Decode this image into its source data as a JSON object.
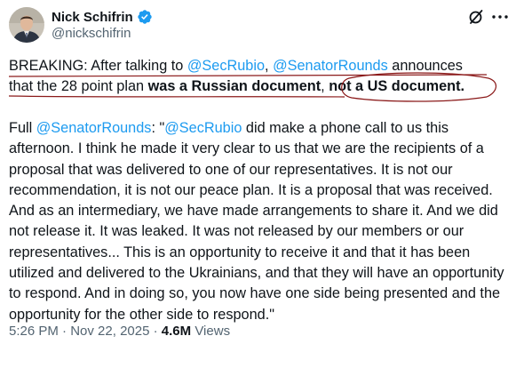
{
  "author": {
    "display_name": "Nick Schifrin",
    "handle": "@nickschifrin",
    "avatar_icon": "person-avatar",
    "verified_icon": "verified-badge-icon"
  },
  "actions": {
    "grok_icon": "grok-icon",
    "more_icon": "more-options-icon"
  },
  "post": {
    "line1": {
      "lead": "BREAKING: After talking to ",
      "mention1": "@SecRubio",
      "sep": ", ",
      "mention2": "@SenatorRounds",
      "tail": " announces"
    },
    "line2": {
      "lead": "that the 28 point plan ",
      "bold1": "was a Russian document",
      "sep": ", ",
      "bold2": "not a US document."
    },
    "para2": {
      "lead": "Full ",
      "mention1": "@SenatorRounds",
      "mid": ": \"",
      "mention2": "@SecRubio",
      "body": " did make a phone call to us this afternoon. I think he made it very clear to us that we are the recipients of a proposal that was delivered to one of our representatives. It is not our recommendation, it is not our peace plan. It is a proposal that was received. And as an intermediary, we have made arrangements to share it. And we did not release it. It was leaked. It was not released by our members or our representatives... This is an opportunity to receive it and that it has been utilized and delivered to the Ukrainians, and that they will have an opportunity to respond. And in doing so, you now have one side being presented and the opportunity for the other side to respond.\""
    }
  },
  "meta": {
    "time": "5:26 PM",
    "dot1": " · ",
    "date": "Nov 22, 2025",
    "dot2": " · ",
    "views_count": "4.6M",
    "views_label": " Views"
  },
  "colors": {
    "link": "#1d9bf0",
    "text": "#0f1419",
    "muted": "#536471",
    "annotation": "#8b1a1a"
  }
}
